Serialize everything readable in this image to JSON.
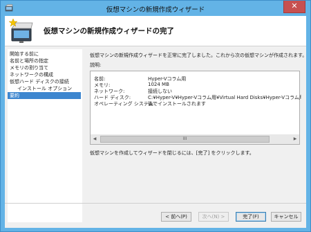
{
  "window": {
    "title": "仮想マシンの新規作成ウィザード",
    "close_glyph": "✕"
  },
  "header": {
    "title": "仮想マシンの新規作成ウィザードの完了"
  },
  "nav": {
    "items": [
      {
        "label": "開始する前に",
        "active": false,
        "sub": false
      },
      {
        "label": "名前と場所の指定",
        "active": false,
        "sub": false
      },
      {
        "label": "メモリの割り当て",
        "active": false,
        "sub": false
      },
      {
        "label": "ネットワークの構成",
        "active": false,
        "sub": false
      },
      {
        "label": "仮想ハード ディスクの接続",
        "active": false,
        "sub": false
      },
      {
        "label": "インストール オプション",
        "active": false,
        "sub": true
      },
      {
        "label": "要約",
        "active": true,
        "sub": false
      }
    ]
  },
  "main": {
    "description": "仮想マシンの新規作成ウィザードを正常に完了しました。これから次の仮想マシンが作成されます。",
    "summary_label": "説明:",
    "summary_rows": [
      {
        "key": "名前:",
        "value": "Hyper-Vコラム用"
      },
      {
        "key": "メモリ:",
        "value": "1024 MB"
      },
      {
        "key": "ネットワーク:",
        "value": "接続しない"
      },
      {
        "key": "ハード ディスク:",
        "value": "C:¥Hyper-V¥Hyper-Vコラム用¥Virtual Hard Disks¥Hyper-Vコラム用.vhdx (VHD"
      },
      {
        "key": "オペレーティング システム:",
        "value": "後でインストールされます"
      }
    ],
    "scroll_thumb_glyph": "III",
    "scroll_left_glyph": "◀",
    "scroll_right_glyph": "▶",
    "finish_note": "仮想マシンを作成してウィザードを閉じるには、[完了] をクリックします。"
  },
  "buttons": {
    "back": "< 前へ(P)",
    "next": "次へ(N) >",
    "finish": "完了(F)",
    "cancel": "キャンセル"
  },
  "colors": {
    "window_frame": "#63b3e6",
    "close": "#c75050",
    "nav_active": "#3d86cf"
  }
}
